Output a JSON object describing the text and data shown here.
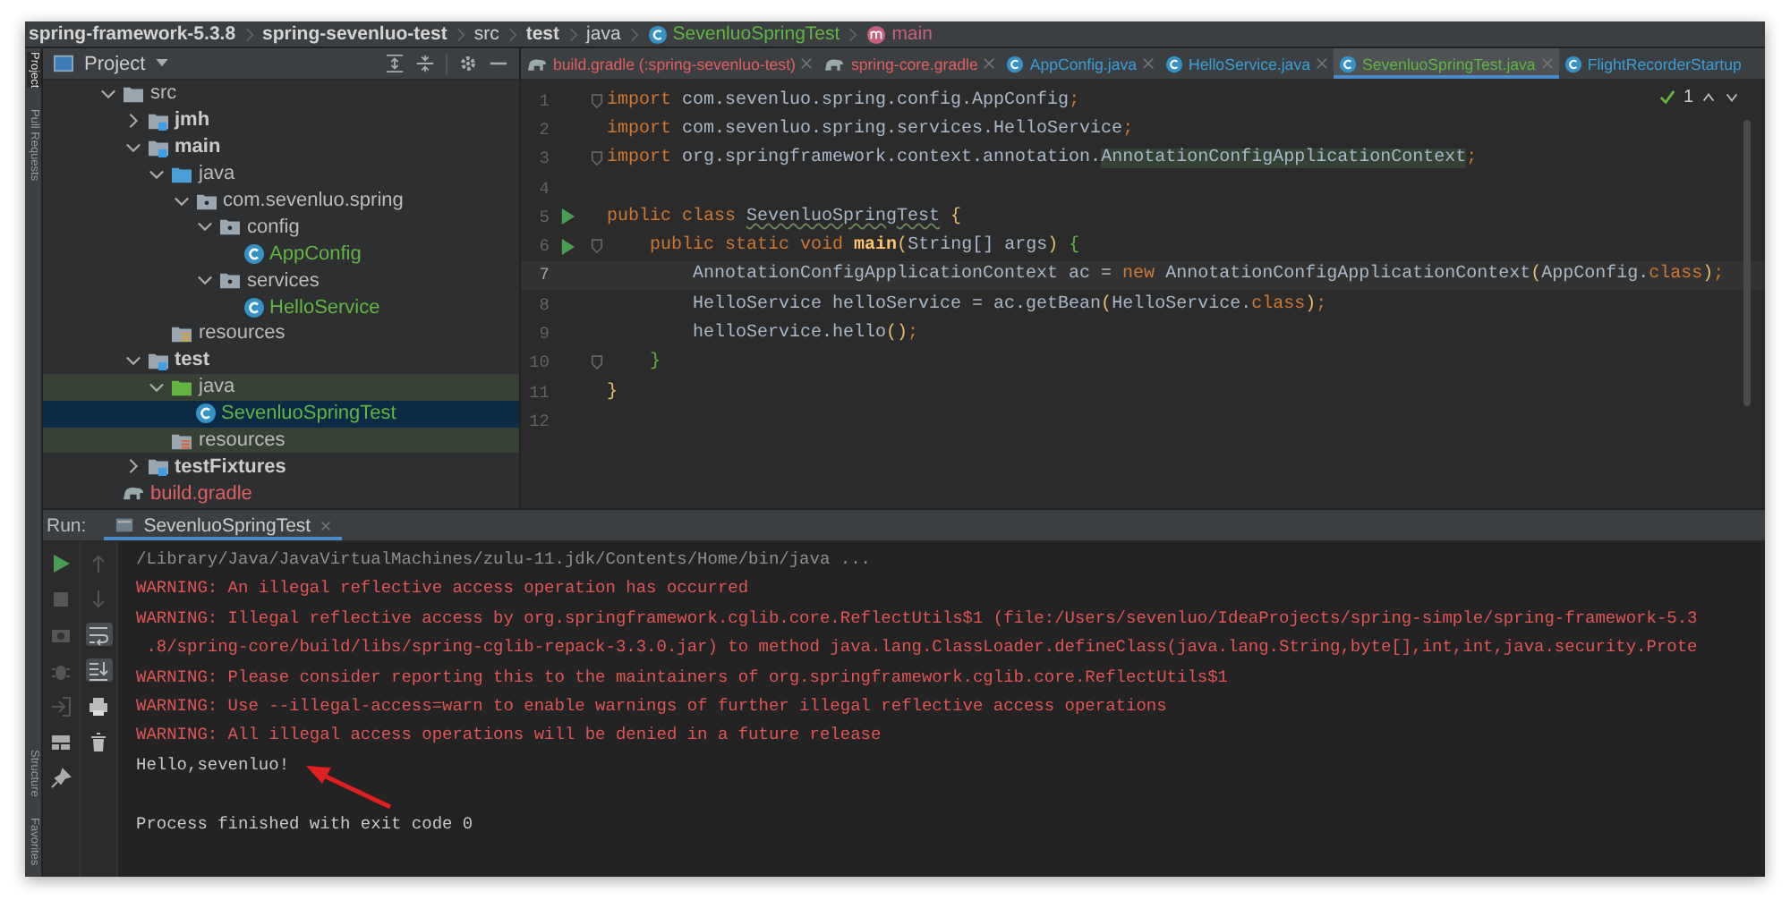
{
  "breadcrumb": [
    {
      "label": "spring-framework-5.3.8",
      "kind": "folder"
    },
    {
      "label": "spring-sevenluo-test",
      "kind": "folder"
    },
    {
      "label": "src",
      "kind": "plain"
    },
    {
      "label": "test",
      "kind": "folder"
    },
    {
      "label": "java",
      "kind": "plain"
    },
    {
      "label": "SevenluoSpringTest",
      "kind": "class"
    },
    {
      "label": "main",
      "kind": "method"
    }
  ],
  "side_tabs": {
    "top": [
      {
        "label": "Project",
        "selected": true
      },
      {
        "label": "Pull Requests",
        "selected": false
      }
    ],
    "bottom": [
      {
        "label": "Structure",
        "selected": false
      },
      {
        "label": "Favorites",
        "selected": false
      }
    ]
  },
  "project": {
    "title": "Project",
    "tree": [
      {
        "label": "src",
        "kind": "folder",
        "expanded": true,
        "selected": false,
        "highlighted": false,
        "children": [
          {
            "label": "jmh",
            "kind": "module",
            "expanded": false,
            "selected": false,
            "highlighted": false
          },
          {
            "label": "main",
            "kind": "module",
            "expanded": true,
            "selected": false,
            "highlighted": false,
            "children": [
              {
                "label": "java",
                "kind": "source",
                "expanded": true,
                "selected": false,
                "highlighted": false,
                "children": [
                  {
                    "label": "com.sevenluo.spring",
                    "kind": "package",
                    "expanded": true,
                    "selected": false,
                    "highlighted": false,
                    "children": [
                      {
                        "label": "config",
                        "kind": "package",
                        "expanded": true,
                        "selected": false,
                        "highlighted": false,
                        "children": [
                          {
                            "label": "AppConfig",
                            "kind": "class",
                            "selected": false,
                            "highlighted": false
                          }
                        ]
                      },
                      {
                        "label": "services",
                        "kind": "package",
                        "expanded": true,
                        "selected": false,
                        "highlighted": false,
                        "children": [
                          {
                            "label": "HelloService",
                            "kind": "class",
                            "selected": false,
                            "highlighted": false
                          }
                        ]
                      }
                    ]
                  }
                ]
              },
              {
                "label": "resources",
                "kind": "resources",
                "selected": false,
                "highlighted": false
              }
            ]
          },
          {
            "label": "test",
            "kind": "module",
            "expanded": true,
            "selected": false,
            "highlighted": false,
            "children": [
              {
                "label": "java",
                "kind": "test-source",
                "expanded": true,
                "selected": false,
                "highlighted": true,
                "children": [
                  {
                    "label": "SevenluoSpringTest",
                    "kind": "class",
                    "selected": true,
                    "highlighted": false
                  }
                ]
              },
              {
                "label": "resources",
                "kind": "test-resources",
                "selected": false,
                "highlighted": true
              }
            ]
          },
          {
            "label": "testFixtures",
            "kind": "module",
            "expanded": false,
            "selected": false,
            "highlighted": false
          }
        ]
      },
      {
        "label": "build.gradle",
        "kind": "gradle",
        "selected": false,
        "highlighted": false
      }
    ]
  },
  "editor": {
    "tabs": [
      {
        "label": "build.gradle (:spring-sevenluo-test)",
        "kind": "gradle",
        "selected": false
      },
      {
        "label": "spring-core.gradle",
        "kind": "gradle",
        "selected": false
      },
      {
        "label": "AppConfig.java",
        "kind": "class",
        "selected": false
      },
      {
        "label": "HelloService.java",
        "kind": "class",
        "selected": false
      },
      {
        "label": "SevenluoSpringTest.java",
        "kind": "class",
        "selected": true
      },
      {
        "label": "FlightRecorderStartup",
        "kind": "class",
        "selected": false
      }
    ],
    "inspection": {
      "count": "1"
    },
    "lines": [
      {
        "number": "1",
        "fold": true,
        "segments": [
          {
            "text": "import",
            "kind": "keyword"
          },
          {
            "text": " com.sevenluo.spring.config.AppConfig",
            "kind": "plain"
          },
          {
            "text": ";",
            "kind": "punct"
          }
        ]
      },
      {
        "number": "2",
        "segments": [
          {
            "text": "import",
            "kind": "keyword"
          },
          {
            "text": " com.sevenluo.spring.services.HelloService",
            "kind": "plain"
          },
          {
            "text": ";",
            "kind": "punct"
          }
        ]
      },
      {
        "number": "3",
        "fold": true,
        "segments": [
          {
            "text": "import",
            "kind": "keyword"
          },
          {
            "text": " org.springframework.context.annotation.",
            "kind": "plain"
          },
          {
            "text": "AnnotationConfigApplicationContext",
            "kind": "resolved"
          },
          {
            "text": ";",
            "kind": "punct"
          }
        ]
      },
      {
        "number": "4"
      },
      {
        "number": "5",
        "run": true,
        "segments": [
          {
            "text": "public class ",
            "kind": "keyword"
          },
          {
            "text": "SevenluoSpringTest",
            "kind": "typo"
          },
          {
            "text": " {",
            "kind": "paren"
          }
        ]
      },
      {
        "number": "6",
        "run": true,
        "fold": true,
        "segments": [
          {
            "text": "    public static void ",
            "kind": "keyword"
          },
          {
            "text": "main",
            "kind": "method"
          },
          {
            "text": "(",
            "kind": "paren"
          },
          {
            "text": "String[] args",
            "kind": "plain"
          },
          {
            "text": ")",
            "kind": "paren"
          },
          {
            "text": " {",
            "kind": "scope"
          }
        ]
      },
      {
        "number": "7",
        "current": true,
        "segments": [
          {
            "text": "        AnnotationConfigApplicationContext ac = ",
            "kind": "plain"
          },
          {
            "text": "new",
            "kind": "keyword"
          },
          {
            "text": " AnnotationConfigApplicationContext",
            "kind": "plain"
          },
          {
            "text": "(",
            "kind": "paren"
          },
          {
            "text": "AppConfig.",
            "kind": "plain"
          },
          {
            "text": "class",
            "kind": "keyword"
          },
          {
            "text": ")",
            "kind": "paren"
          },
          {
            "text": ";",
            "kind": "punct"
          }
        ]
      },
      {
        "number": "8",
        "segments": [
          {
            "text": "        HelloService helloService = ac.getBean",
            "kind": "plain"
          },
          {
            "text": "(",
            "kind": "paren"
          },
          {
            "text": "HelloService.",
            "kind": "plain"
          },
          {
            "text": "class",
            "kind": "keyword"
          },
          {
            "text": ")",
            "kind": "paren"
          },
          {
            "text": ";",
            "kind": "punct"
          }
        ]
      },
      {
        "number": "9",
        "segments": [
          {
            "text": "        helloService.hello",
            "kind": "plain"
          },
          {
            "text": "()",
            "kind": "paren"
          },
          {
            "text": ";",
            "kind": "punct"
          }
        ]
      },
      {
        "number": "10",
        "fold": true,
        "segments": [
          {
            "text": "    }",
            "kind": "scope"
          }
        ]
      },
      {
        "number": "11",
        "segments": [
          {
            "text": "}",
            "kind": "paren"
          }
        ]
      },
      {
        "number": "12"
      }
    ]
  },
  "run": {
    "label": "Run:",
    "tab": "SevenluoSpringTest",
    "tools_left": [
      {
        "kind": "run",
        "on": false
      },
      {
        "kind": "stop",
        "on": false
      },
      {
        "kind": "camera",
        "on": false
      },
      {
        "kind": "debug",
        "on": false
      },
      {
        "kind": "exit",
        "on": false
      },
      {
        "kind": "layout",
        "on": false
      },
      {
        "kind": "pin",
        "on": false
      }
    ],
    "tools_right": [
      {
        "kind": "up",
        "on": false
      },
      {
        "kind": "down",
        "on": false
      },
      {
        "kind": "wrap",
        "on": true
      },
      {
        "kind": "scroll-end",
        "on": true
      },
      {
        "kind": "print",
        "on": false
      },
      {
        "kind": "trash",
        "on": false
      }
    ],
    "console": [
      {
        "kind": "command",
        "text": "/Library/Java/JavaVirtualMachines/zulu-11.jdk/Contents/Home/bin/java ..."
      },
      {
        "kind": "error",
        "text": "WARNING: An illegal reflective access operation has occurred"
      },
      {
        "kind": "error",
        "text": "WARNING: Illegal reflective access by org.springframework.cglib.core.ReflectUtils$1 (file:/Users/sevenluo/IdeaProjects/spring-simple/spring-framework-5.3"
      },
      {
        "kind": "error",
        "text": " .8/spring-core/build/libs/spring-cglib-repack-3.3.0.jar) to method java.lang.ClassLoader.defineClass(java.lang.String,byte[],int,int,java.security.Prote"
      },
      {
        "kind": "error",
        "text": "WARNING: Please consider reporting this to the maintainers of org.springframework.cglib.core.ReflectUtils$1"
      },
      {
        "kind": "error",
        "text": "WARNING: Use --illegal-access=warn to enable warnings of further illegal reflective access operations"
      },
      {
        "kind": "error",
        "text": "WARNING: All illegal access operations will be denied in a future release"
      },
      {
        "kind": "output",
        "text": "Hello,sevenluo!"
      },
      {
        "kind": "blank"
      },
      {
        "kind": "output",
        "text": "Process finished with exit code 0"
      }
    ]
  }
}
